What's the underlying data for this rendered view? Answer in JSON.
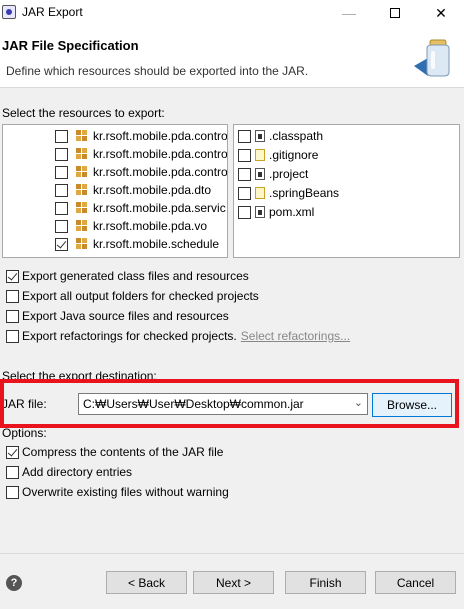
{
  "window": {
    "title": "JAR Export",
    "minimize_glyph": "—",
    "close_glyph": "✕"
  },
  "banner": {
    "heading": "JAR File Specification",
    "description": "Define which resources should be exported into the JAR."
  },
  "resources": {
    "label": "Select the resources to export:",
    "tree_items": [
      {
        "label": "kr.rsoft.mobile.pda.contro",
        "checked": false
      },
      {
        "label": "kr.rsoft.mobile.pda.contro",
        "checked": false
      },
      {
        "label": "kr.rsoft.mobile.pda.contro",
        "checked": false
      },
      {
        "label": "kr.rsoft.mobile.pda.dto",
        "checked": false
      },
      {
        "label": "kr.rsoft.mobile.pda.servic",
        "checked": false
      },
      {
        "label": "kr.rsoft.mobile.pda.vo",
        "checked": false
      },
      {
        "label": "kr.rsoft.mobile.schedule",
        "checked": true
      }
    ],
    "files": [
      {
        "label": ".classpath",
        "checked": false,
        "icon": "classpath-file-icon"
      },
      {
        "label": ".gitignore",
        "checked": false,
        "icon": "text-file-icon"
      },
      {
        "label": ".project",
        "checked": false,
        "icon": "project-file-icon"
      },
      {
        "label": ".springBeans",
        "checked": false,
        "icon": "text-file-icon"
      },
      {
        "label": "pom.xml",
        "checked": false,
        "icon": "xml-file-icon"
      }
    ]
  },
  "export_options": [
    {
      "label": "Export generated class files and resources",
      "checked": true
    },
    {
      "label": "Export all output folders for checked projects",
      "checked": false
    },
    {
      "label": "Export Java source files and resources",
      "checked": false
    },
    {
      "label": "Export refactorings for checked projects.",
      "checked": false
    }
  ],
  "select_refactorings_link": "Select refactorings...",
  "destination": {
    "label": "Select the export destination:",
    "jar_file_label": "JAR file:",
    "jar_file_value": "C:₩Users₩User₩Desktop₩common.jar",
    "browse_label": "Browse..."
  },
  "options": {
    "label": "Options:",
    "items": [
      {
        "label": "Compress the contents of the JAR file",
        "checked": true
      },
      {
        "label": "Add directory entries",
        "checked": false
      },
      {
        "label": "Overwrite existing files without warning",
        "checked": false
      }
    ]
  },
  "footer": {
    "help_glyph": "?",
    "back_label": "< Back",
    "next_label": "Next >",
    "finish_label": "Finish",
    "cancel_label": "Cancel"
  },
  "colors": {
    "highlight": "#e8131c",
    "focus_border": "#0078d7"
  }
}
